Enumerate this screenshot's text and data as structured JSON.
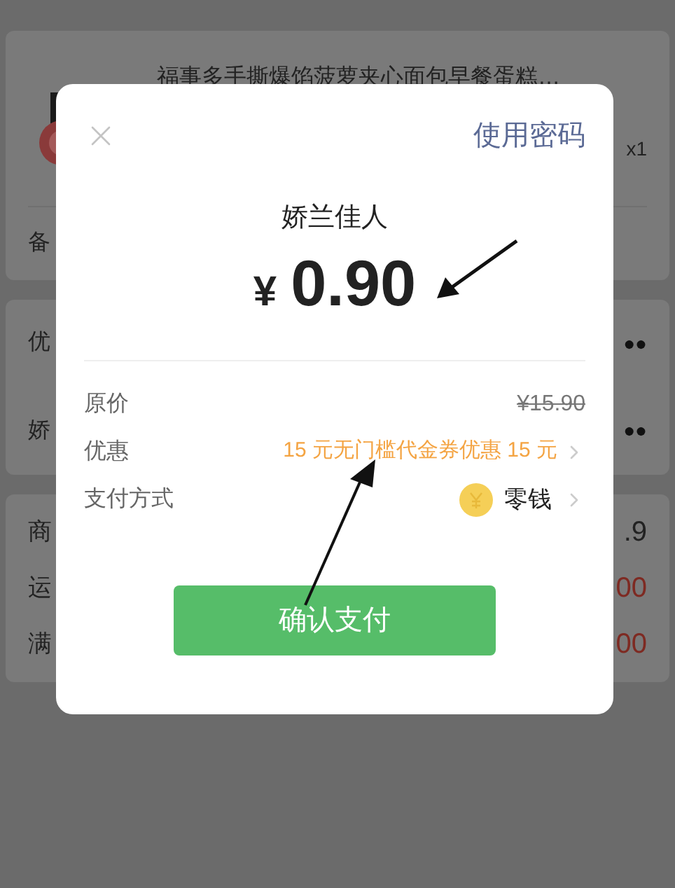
{
  "order": {
    "product": {
      "kind": "picture",
      "title": "福事多手撕爆馅菠萝夹心面包早餐蛋糕…",
      "quantity": "x1"
    },
    "remark_label": "备",
    "discount_rows": [
      {
        "label": "优",
        "value": "●●"
      },
      {
        "label": "娇",
        "value": "●●"
      }
    ],
    "summary_rows": [
      {
        "label": "商",
        "value": ".9",
        "highlight": false
      },
      {
        "label": "运",
        "value": "00",
        "highlight": true
      },
      {
        "label": "满",
        "value": "00",
        "highlight": true
      }
    ]
  },
  "payment_dialog": {
    "use_password": "使用密码",
    "merchant": "娇兰佳人",
    "currency": "¥",
    "amount": "0.90",
    "details": [
      {
        "kind": "strike",
        "label": "原价",
        "value": "¥15.90"
      },
      {
        "kind": "offer",
        "label": "优惠",
        "value": "15 元无门槛代金券优惠 15 元"
      },
      {
        "kind": "method",
        "label": "支付方式",
        "value": "零钱"
      }
    ],
    "confirm": "确认支付"
  }
}
